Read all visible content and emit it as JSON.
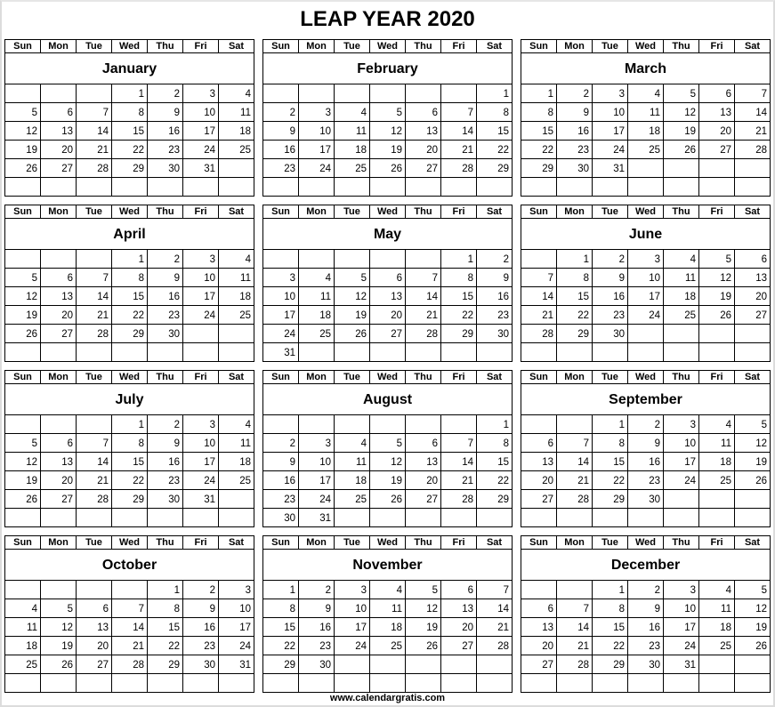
{
  "title": "LEAP YEAR 2020",
  "footer": "www.calendargratis.com",
  "weekdays": [
    "Sun",
    "Mon",
    "Tue",
    "Wed",
    "Thu",
    "Fri",
    "Sat"
  ],
  "months": [
    {
      "name": "January",
      "weeks": [
        [
          "",
          "",
          "",
          "1",
          "2",
          "3",
          "4"
        ],
        [
          "5",
          "6",
          "7",
          "8",
          "9",
          "10",
          "11"
        ],
        [
          "12",
          "13",
          "14",
          "15",
          "16",
          "17",
          "18"
        ],
        [
          "19",
          "20",
          "21",
          "22",
          "23",
          "24",
          "25"
        ],
        [
          "26",
          "27",
          "28",
          "29",
          "30",
          "31",
          ""
        ],
        [
          "",
          "",
          "",
          "",
          "",
          "",
          ""
        ]
      ]
    },
    {
      "name": "February",
      "weeks": [
        [
          "",
          "",
          "",
          "",
          "",
          "",
          "1"
        ],
        [
          "2",
          "3",
          "4",
          "5",
          "6",
          "7",
          "8"
        ],
        [
          "9",
          "10",
          "11",
          "12",
          "13",
          "14",
          "15"
        ],
        [
          "16",
          "17",
          "18",
          "19",
          "20",
          "21",
          "22"
        ],
        [
          "23",
          "24",
          "25",
          "26",
          "27",
          "28",
          "29"
        ],
        [
          "",
          "",
          "",
          "",
          "",
          "",
          ""
        ]
      ]
    },
    {
      "name": "March",
      "weeks": [
        [
          "1",
          "2",
          "3",
          "4",
          "5",
          "6",
          "7"
        ],
        [
          "8",
          "9",
          "10",
          "11",
          "12",
          "13",
          "14"
        ],
        [
          "15",
          "16",
          "17",
          "18",
          "19",
          "20",
          "21"
        ],
        [
          "22",
          "23",
          "24",
          "25",
          "26",
          "27",
          "28"
        ],
        [
          "29",
          "30",
          "31",
          "",
          "",
          "",
          ""
        ],
        [
          "",
          "",
          "",
          "",
          "",
          "",
          ""
        ]
      ]
    },
    {
      "name": "April",
      "weeks": [
        [
          "",
          "",
          "",
          "1",
          "2",
          "3",
          "4"
        ],
        [
          "5",
          "6",
          "7",
          "8",
          "9",
          "10",
          "11"
        ],
        [
          "12",
          "13",
          "14",
          "15",
          "16",
          "17",
          "18"
        ],
        [
          "19",
          "20",
          "21",
          "22",
          "23",
          "24",
          "25"
        ],
        [
          "26",
          "27",
          "28",
          "29",
          "30",
          "",
          ""
        ],
        [
          "",
          "",
          "",
          "",
          "",
          "",
          ""
        ]
      ]
    },
    {
      "name": "May",
      "weeks": [
        [
          "",
          "",
          "",
          "",
          "",
          "1",
          "2"
        ],
        [
          "3",
          "4",
          "5",
          "6",
          "7",
          "8",
          "9"
        ],
        [
          "10",
          "11",
          "12",
          "13",
          "14",
          "15",
          "16"
        ],
        [
          "17",
          "18",
          "19",
          "20",
          "21",
          "22",
          "23"
        ],
        [
          "24",
          "25",
          "26",
          "27",
          "28",
          "29",
          "30"
        ],
        [
          "31",
          "",
          "",
          "",
          "",
          "",
          ""
        ]
      ]
    },
    {
      "name": "June",
      "weeks": [
        [
          "",
          "1",
          "2",
          "3",
          "4",
          "5",
          "6"
        ],
        [
          "7",
          "8",
          "9",
          "10",
          "11",
          "12",
          "13"
        ],
        [
          "14",
          "15",
          "16",
          "17",
          "18",
          "19",
          "20"
        ],
        [
          "21",
          "22",
          "23",
          "24",
          "25",
          "26",
          "27"
        ],
        [
          "28",
          "29",
          "30",
          "",
          "",
          "",
          ""
        ],
        [
          "",
          "",
          "",
          "",
          "",
          "",
          ""
        ]
      ]
    },
    {
      "name": "July",
      "weeks": [
        [
          "",
          "",
          "",
          "1",
          "2",
          "3",
          "4"
        ],
        [
          "5",
          "6",
          "7",
          "8",
          "9",
          "10",
          "11"
        ],
        [
          "12",
          "13",
          "14",
          "15",
          "16",
          "17",
          "18"
        ],
        [
          "19",
          "20",
          "21",
          "22",
          "23",
          "24",
          "25"
        ],
        [
          "26",
          "27",
          "28",
          "29",
          "30",
          "31",
          ""
        ],
        [
          "",
          "",
          "",
          "",
          "",
          "",
          ""
        ]
      ]
    },
    {
      "name": "August",
      "weeks": [
        [
          "",
          "",
          "",
          "",
          "",
          "",
          "1"
        ],
        [
          "2",
          "3",
          "4",
          "5",
          "6",
          "7",
          "8"
        ],
        [
          "9",
          "10",
          "11",
          "12",
          "13",
          "14",
          "15"
        ],
        [
          "16",
          "17",
          "18",
          "19",
          "20",
          "21",
          "22"
        ],
        [
          "23",
          "24",
          "25",
          "26",
          "27",
          "28",
          "29"
        ],
        [
          "30",
          "31",
          "",
          "",
          "",
          "",
          ""
        ]
      ]
    },
    {
      "name": "September",
      "weeks": [
        [
          "",
          "",
          "1",
          "2",
          "3",
          "4",
          "5"
        ],
        [
          "6",
          "7",
          "8",
          "9",
          "10",
          "11",
          "12"
        ],
        [
          "13",
          "14",
          "15",
          "16",
          "17",
          "18",
          "19"
        ],
        [
          "20",
          "21",
          "22",
          "23",
          "24",
          "25",
          "26"
        ],
        [
          "27",
          "28",
          "29",
          "30",
          "",
          "",
          ""
        ],
        [
          "",
          "",
          "",
          "",
          "",
          "",
          ""
        ]
      ]
    },
    {
      "name": "October",
      "weeks": [
        [
          "",
          "",
          "",
          "",
          "1",
          "2",
          "3"
        ],
        [
          "4",
          "5",
          "6",
          "7",
          "8",
          "9",
          "10"
        ],
        [
          "11",
          "12",
          "13",
          "14",
          "15",
          "16",
          "17"
        ],
        [
          "18",
          "19",
          "20",
          "21",
          "22",
          "23",
          "24"
        ],
        [
          "25",
          "26",
          "27",
          "28",
          "29",
          "30",
          "31"
        ],
        [
          "",
          "",
          "",
          "",
          "",
          "",
          ""
        ]
      ]
    },
    {
      "name": "November",
      "weeks": [
        [
          "1",
          "2",
          "3",
          "4",
          "5",
          "6",
          "7"
        ],
        [
          "8",
          "9",
          "10",
          "11",
          "12",
          "13",
          "14"
        ],
        [
          "15",
          "16",
          "17",
          "18",
          "19",
          "20",
          "21"
        ],
        [
          "22",
          "23",
          "24",
          "25",
          "26",
          "27",
          "28"
        ],
        [
          "29",
          "30",
          "",
          "",
          "",
          "",
          ""
        ],
        [
          "",
          "",
          "",
          "",
          "",
          "",
          ""
        ]
      ]
    },
    {
      "name": "December",
      "weeks": [
        [
          "",
          "",
          "1",
          "2",
          "3",
          "4",
          "5"
        ],
        [
          "6",
          "7",
          "8",
          "9",
          "10",
          "11",
          "12"
        ],
        [
          "13",
          "14",
          "15",
          "16",
          "17",
          "18",
          "19"
        ],
        [
          "20",
          "21",
          "22",
          "23",
          "24",
          "25",
          "26"
        ],
        [
          "27",
          "28",
          "29",
          "30",
          "31",
          "",
          ""
        ],
        [
          "",
          "",
          "",
          "",
          "",
          "",
          ""
        ]
      ]
    }
  ]
}
